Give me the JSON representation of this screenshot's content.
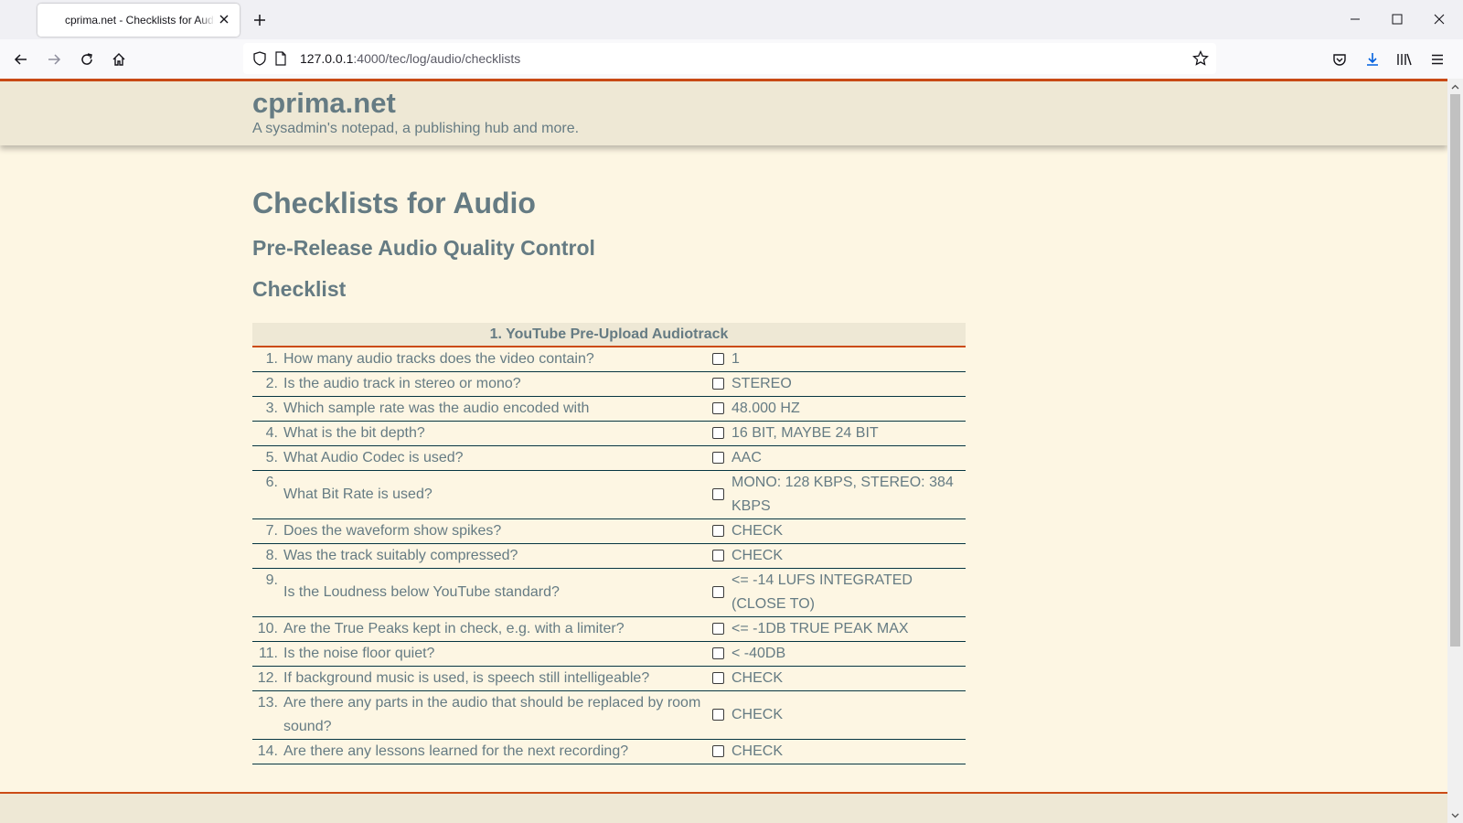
{
  "browser": {
    "tab_title": "cprima.net - Checklists for Audio",
    "new_tab_icon": "plus-icon",
    "url_host": "127.0.0.1",
    "url_rest": ":4000/tec/log/audio/checklists"
  },
  "site": {
    "name": "cprima.net",
    "description": "A sysadmin's notepad, a publishing hub and more."
  },
  "page": {
    "title": "Checklists for Audio",
    "subtitle": "Pre-Release Audio Quality Control",
    "section": "Checklist"
  },
  "table": {
    "header": "1. YouTube Pre-Upload Audiotrack",
    "rows": [
      {
        "num": "1.",
        "q": "How many audio tracks does the video contain?",
        "a": "1"
      },
      {
        "num": "2.",
        "q": "Is the audio track in stereo or mono?",
        "a": "STEREO"
      },
      {
        "num": "3.",
        "q": "Which sample rate was the audio encoded with",
        "a": "48.000 HZ"
      },
      {
        "num": "4.",
        "q": "What is the bit depth?",
        "a": "16 BIT, MAYBE 24 BIT"
      },
      {
        "num": "5.",
        "q": "What Audio Codec is used?",
        "a": "AAC"
      },
      {
        "num": "6.",
        "q": "What Bit Rate is used?",
        "a": "MONO: 128 KBPS, STEREO: 384 KBPS"
      },
      {
        "num": "7.",
        "q": "Does the waveform show spikes?",
        "a": "CHECK"
      },
      {
        "num": "8.",
        "q": "Was the track suitably compressed?",
        "a": "CHECK"
      },
      {
        "num": "9.",
        "q": "Is the Loudness below YouTube standard?",
        "a": "<= -14 LUFS INTEGRATED (CLOSE TO)"
      },
      {
        "num": "10.",
        "q": "Are the True Peaks kept in check, e.g. with a limiter?",
        "a": "<= -1DB TRUE PEAK MAX"
      },
      {
        "num": "11.",
        "q": "Is the noise floor quiet?",
        "a": "< -40DB"
      },
      {
        "num": "12.",
        "q": "If background music is used, is speech still intelligeable?",
        "a": "CHECK"
      },
      {
        "num": "13.",
        "q": "Are there any parts in the audio that should be replaced by room sound?",
        "a": "CHECK"
      },
      {
        "num": "14.",
        "q": "Are there any lessons learned for the next recording?",
        "a": "CHECK"
      }
    ]
  },
  "colors": {
    "page_bg": "#fdf6e3",
    "header_bg": "#eee8d5",
    "accent": "#cb4b16",
    "text": "#657b83"
  }
}
